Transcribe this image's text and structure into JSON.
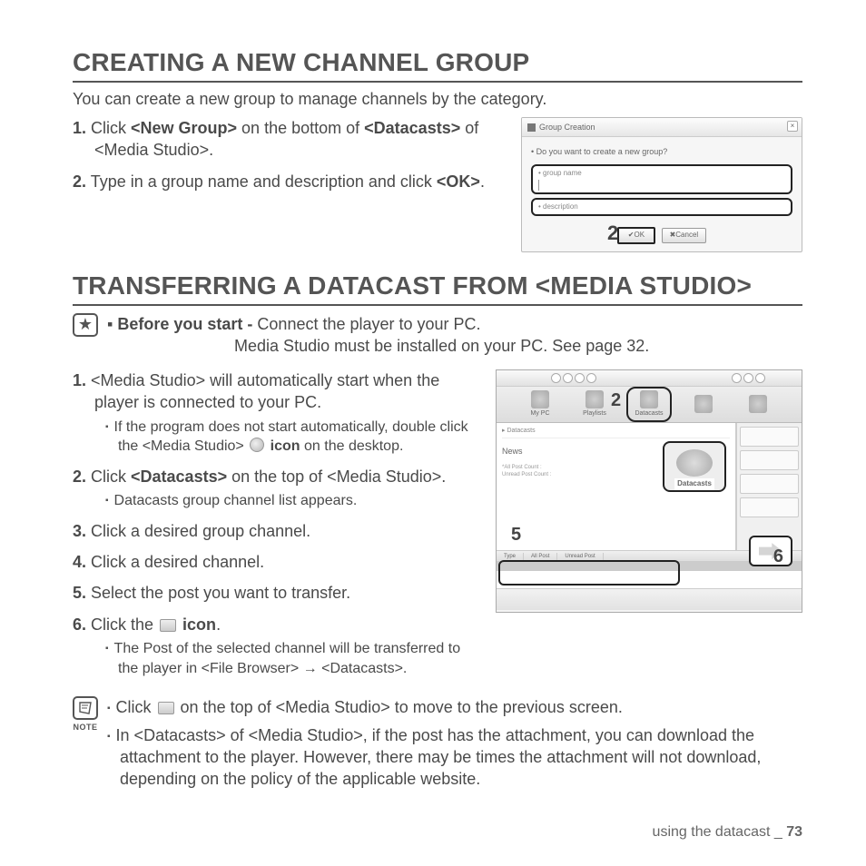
{
  "section1": {
    "heading": "CREATING A NEW CHANNEL GROUP",
    "intro": "You can create a new group to manage channels by the category.",
    "step1_num": "1.",
    "step1_a": " Click ",
    "step1_b": "<New Group>",
    "step1_c": " on the bottom of ",
    "step1_d": "<Datacasts>",
    "step1_e": " of <Media Studio>.",
    "step2_num": "2.",
    "step2_a": " Type in a group name and description and click ",
    "step2_b": "<OK>",
    "step2_c": "."
  },
  "dialog": {
    "title": "Group Creation",
    "question": "Do you want to create a new group?",
    "field1": "group name",
    "field2": "description",
    "ok": "OK",
    "cancel": "Cancel",
    "callout": "2"
  },
  "section2": {
    "heading": "TRANSFERRING A DATACAST FROM <MEDIA STUDIO>",
    "before_label": "Before you start - ",
    "before_a": "Connect the player to your PC.",
    "before_b": "Media Studio must be installed on your PC. See page 32.",
    "s1_num": "1.",
    "s1_txt": " <Media Studio> will automatically start when the player is connected to your PC.",
    "s1_sub_a": "If the program does not start automatically, double click the <Media Studio> ",
    "s1_sub_b": " icon",
    "s1_sub_c": " on the desktop.",
    "s2_num": "2.",
    "s2_a": " Click ",
    "s2_b": "<Datacasts>",
    "s2_c": " on the top of <Media Studio>.",
    "s2_sub": "Datacasts group channel list appears.",
    "s3_num": "3.",
    "s3_txt": " Click a desired group channel.",
    "s4_num": "4.",
    "s4_txt": " Click a desired channel.",
    "s5_num": "5.",
    "s5_txt": " Select the post you want to transfer.",
    "s6_num": "6.",
    "s6_a": " Click the ",
    "s6_b": " icon",
    "s6_c": ".",
    "s6_sub": "The Post of the selected channel will be transferred to the player in <File Browser> → <Datacasts>."
  },
  "notes": {
    "label": "NOTE",
    "n1_a": "Click ",
    "n1_b": " on the top of <Media Studio> to move to the previous screen.",
    "n2": "In <Datacasts> of <Media Studio>, if the post has the attachment, you can download the attachment to the player. However, there may be times the attachment will not download, depending on the policy of the applicable website."
  },
  "ms": {
    "tab_mypc": "My PC",
    "tab_playlists": "Playlists",
    "tab_datacasts": "Datacasts",
    "crumb": "Datacasts",
    "news": "News",
    "counts1": "*All Post Count :",
    "counts2": "Unread Post Count :",
    "biglabel": "Datacasts",
    "hdr_type": "Type",
    "hdr_all": "All Post",
    "hdr_unread": "Unread Post",
    "c2": "2",
    "c5": "5",
    "c6": "6"
  },
  "footer": {
    "text": "using the datacast _ ",
    "page": "73"
  }
}
